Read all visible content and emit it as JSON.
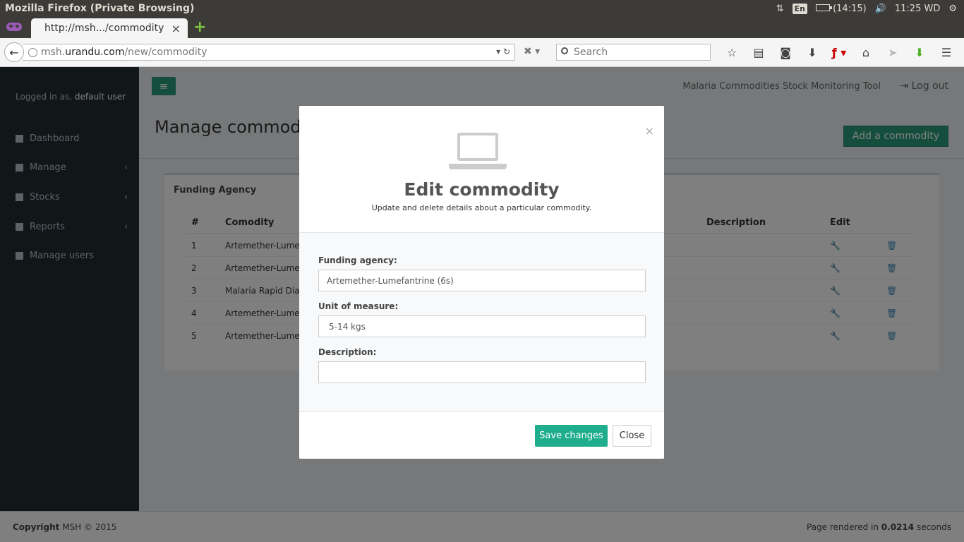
{
  "os": {
    "window_title": "Mozilla Firefox (Private Browsing)",
    "lang": "En",
    "battery": "(14:15)",
    "clock": "11:25 WD"
  },
  "browser": {
    "tab_title": "http://msh.../commodity",
    "tab_close": "×",
    "new_tab": "+",
    "url_prefix": "msh.",
    "url_domain": "urandu.com",
    "url_path": "/new/commodity",
    "search_placeholder": "Search"
  },
  "app": {
    "logged_in_prefix": "Logged in as,",
    "logged_in_user": "default user",
    "menu": [
      {
        "label": "Dashboard",
        "icon": "dashboard-icon"
      },
      {
        "label": "Manage",
        "icon": "manage-icon"
      },
      {
        "label": "Stocks",
        "icon": "stocks-icon"
      },
      {
        "label": "Reports",
        "icon": "reports-icon"
      },
      {
        "label": "Manage users",
        "icon": "users-icon"
      }
    ],
    "header_title": "Malaria Commodities Stock Monitoring Tool",
    "logout": "Log out",
    "page_title": "Manage commodities",
    "add_button": "Add a commodity",
    "box_title": "Funding Agency",
    "table": {
      "headers": {
        "num": "#",
        "commodity": "Comodity",
        "description": "Description",
        "edit": "Edit"
      },
      "rows": [
        {
          "num": "1",
          "commodity": "Artemether-Lumefa"
        },
        {
          "num": "2",
          "commodity": "Artemether-Lumefa"
        },
        {
          "num": "3",
          "commodity": "Malaria Rapid Diagn"
        },
        {
          "num": "4",
          "commodity": "Artemether-Lumefa"
        },
        {
          "num": "5",
          "commodity": "Artemether-Lumefa"
        }
      ]
    },
    "footer_copyright": "Copyright",
    "footer_rest": "MSH © 2015",
    "footer_right_prefix": "Page rendered in",
    "footer_right_value": "0.0214",
    "footer_right_suffix": "seconds"
  },
  "modal": {
    "close": "×",
    "title": "Edit commodity",
    "subtitle": "Update and delete details about a particular commodity.",
    "funding_label": "Funding agency:",
    "funding_value": "Artemether-Lumefantrine (6s)",
    "unit_label": "Unit of measure:",
    "unit_value": "5-14 kgs",
    "description_label": "Description:",
    "description_value": "",
    "save": "Save changes",
    "cancel": "Close"
  },
  "colors": {
    "accent": "#1fae8d",
    "sidebar": "#222d32"
  }
}
